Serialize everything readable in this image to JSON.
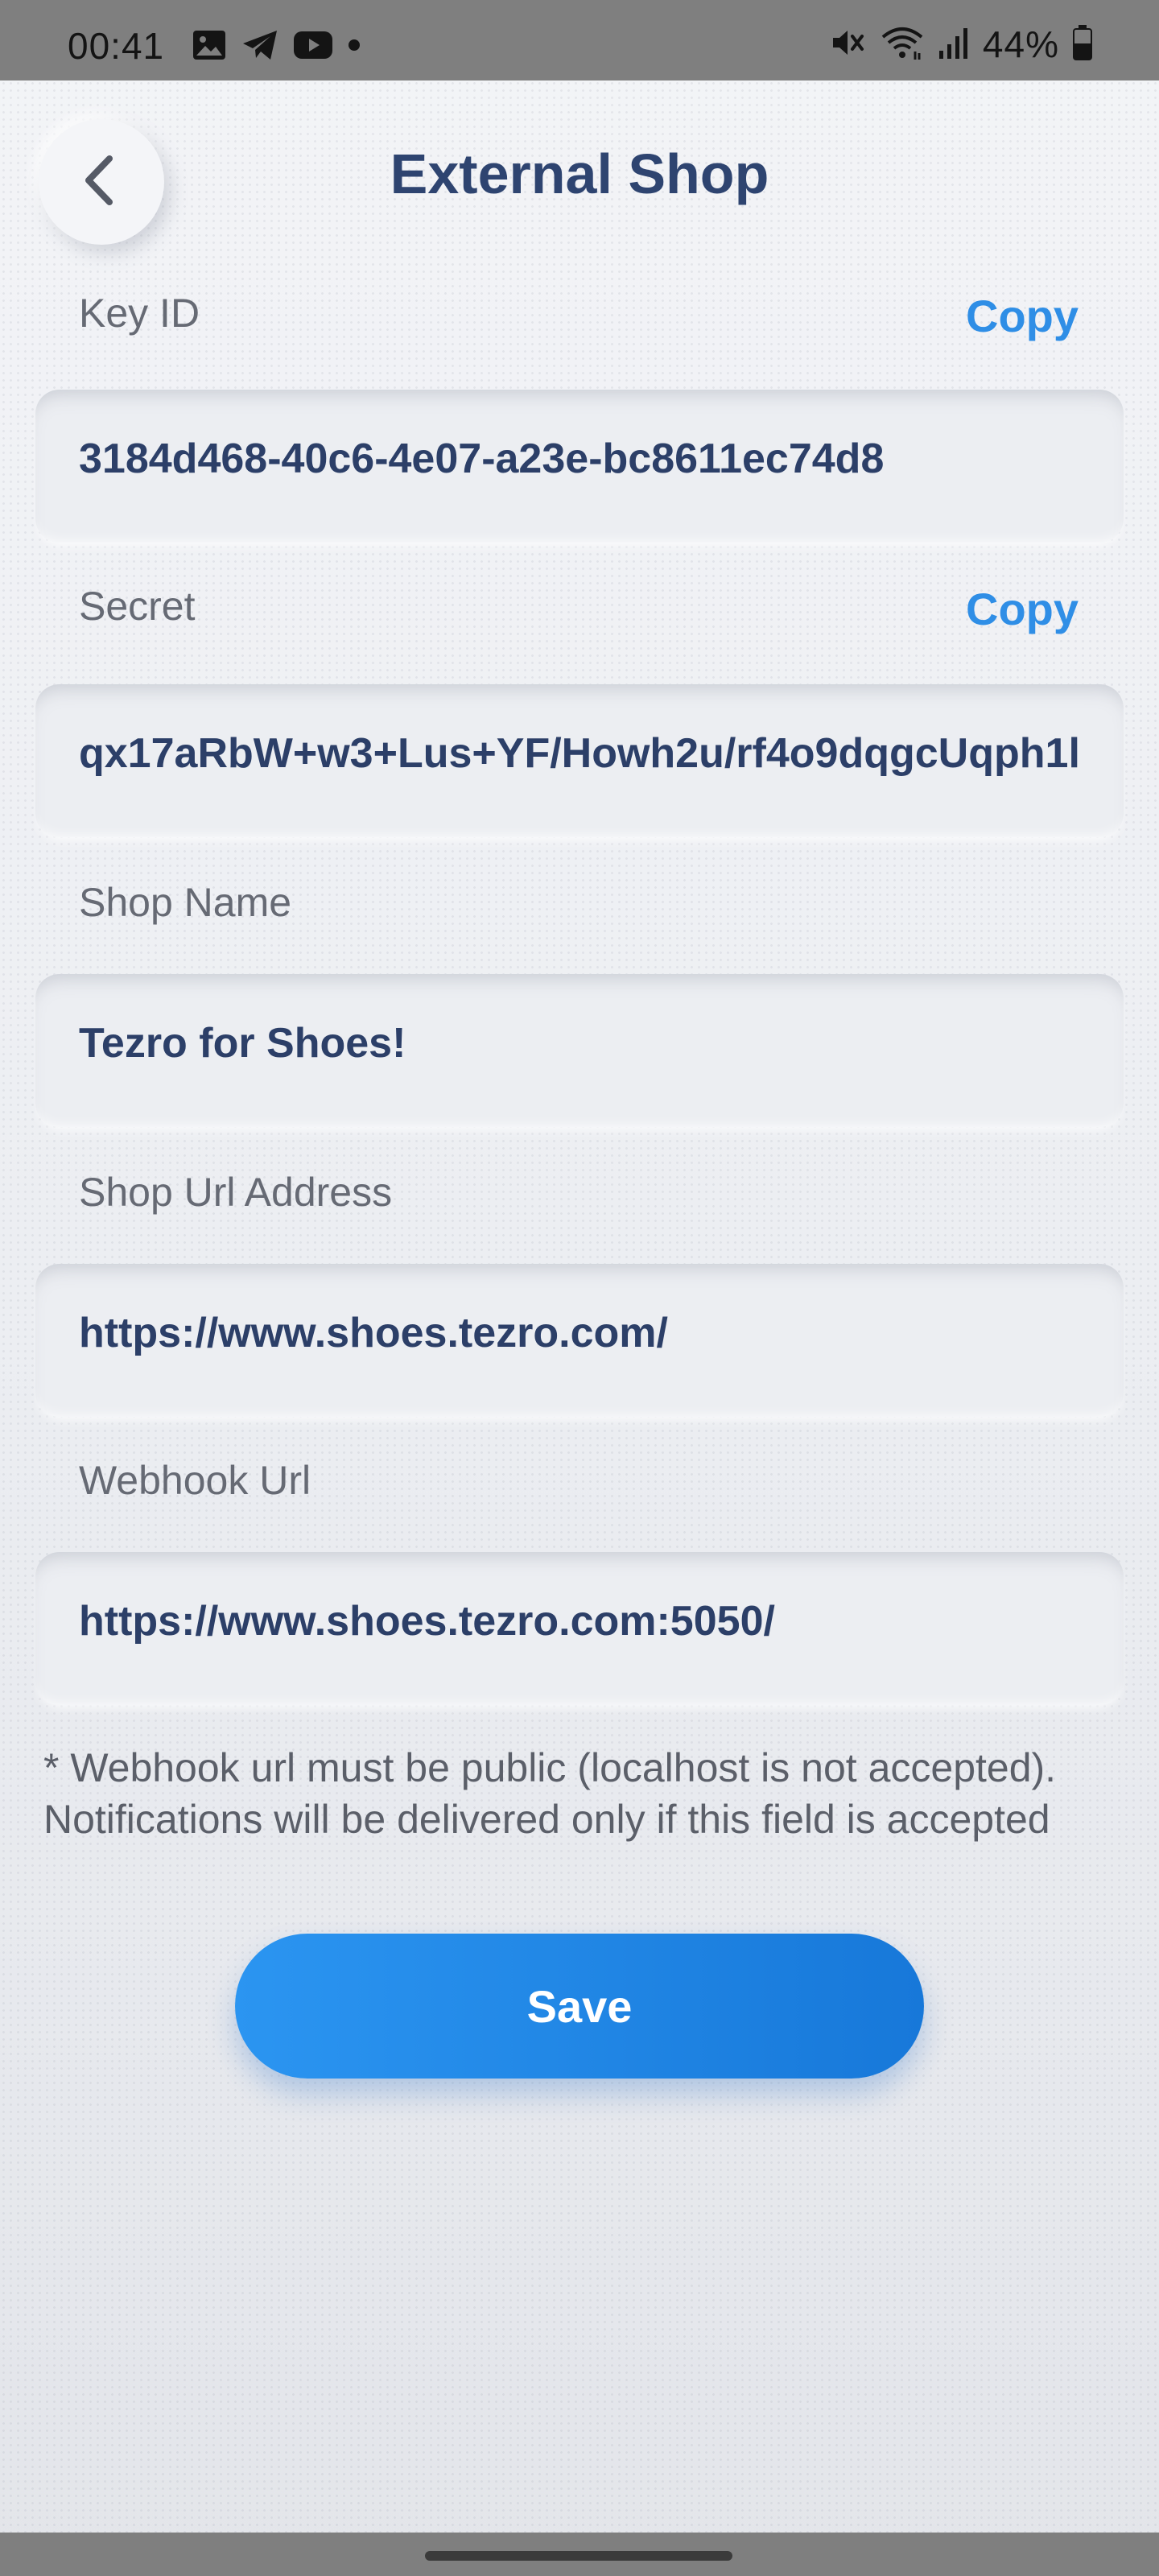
{
  "status_bar": {
    "time": "00:41",
    "battery": "44%",
    "icons_left": [
      "gallery-icon",
      "telegram-icon",
      "youtube-icon",
      "dot-icon"
    ],
    "icons_right": [
      "mute-icon",
      "wifi-icon",
      "signal-icon",
      "battery-icon"
    ]
  },
  "header": {
    "title": "External Shop",
    "back_icon": "chevron-left-icon"
  },
  "fields": {
    "key_id": {
      "label": "Key ID",
      "copy_label": "Copy",
      "value": "3184d468-40c6-4e07-a23e-bc8611ec74d8"
    },
    "secret": {
      "label": "Secret",
      "copy_label": "Copy",
      "value": "qx17aRbW+w3+Lus+YF/Howh2u/rf4o9dqgcUqph1l"
    },
    "shop_name": {
      "label": "Shop Name",
      "value": "Tezro for Shoes!"
    },
    "shop_url": {
      "label": "Shop Url Address",
      "value": "https://www.shoes.tezro.com/"
    },
    "webhook_url": {
      "label": "Webhook Url",
      "value": "https://www.shoes.tezro.com:5050/"
    }
  },
  "note": {
    "line1": "* Webhook url must be public (localhost is not accepted).",
    "line2": "Notifications will be delivered only if this field is accepted"
  },
  "save_label": "Save",
  "colors": {
    "accent": "#2f8ee6",
    "title": "#2e4470",
    "value_text": "#2c3f68",
    "button_start": "#2b95f1",
    "button_end": "#1778d9"
  }
}
